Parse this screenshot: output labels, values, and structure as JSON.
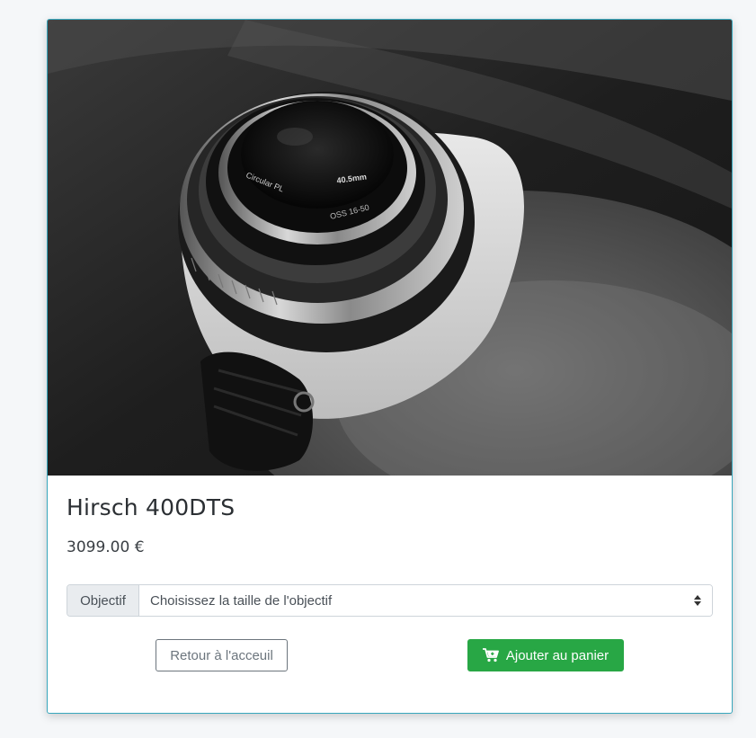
{
  "product": {
    "name": "Hirsch 400DTS",
    "price": "3099.00 €"
  },
  "options": {
    "addon_label": "Objectif",
    "selected_value": "Choisissez la taille de l'objectif"
  },
  "buttons": {
    "back_label": "Retour à l'acceuil",
    "cart_label": "Ajouter au panier"
  },
  "photo": {
    "lens_ring_text": "Circular PL",
    "lens_size_text": "40.5mm",
    "lens_model_text": "OSS 16-50"
  },
  "colors": {
    "card_border": "#38a7bd",
    "cart_button": "#28a745",
    "back_button": "#6c757d"
  },
  "icons": {
    "cart": "cart-plus-icon",
    "select": "sort-icon"
  }
}
